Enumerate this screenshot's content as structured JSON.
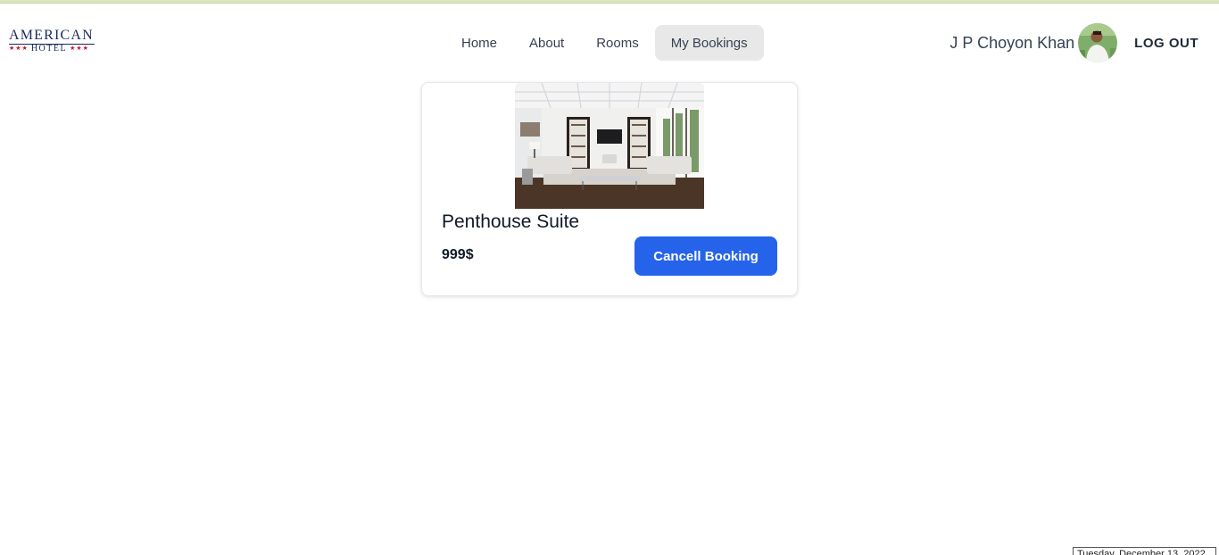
{
  "brand": {
    "logo_word": "AMERICAN",
    "logo_sub": "HOTEL",
    "logo_stars": "★★★",
    "accent": "#1b2a5c",
    "star_color": "#c8102e"
  },
  "nav": {
    "items": [
      {
        "label": "Home"
      },
      {
        "label": "About"
      },
      {
        "label": "Rooms"
      },
      {
        "label": "My Bookings"
      }
    ],
    "active": "My Bookings"
  },
  "user": {
    "name": "J P Choyon Khan",
    "logout_label": "LOG OUT"
  },
  "booking": {
    "title": "Penthouse Suite",
    "price": "999$",
    "cancel_label": "Cancell Booking",
    "button_color": "#2563eb"
  },
  "footer": {
    "date_text": "Tuesday, December 13, 2022"
  }
}
